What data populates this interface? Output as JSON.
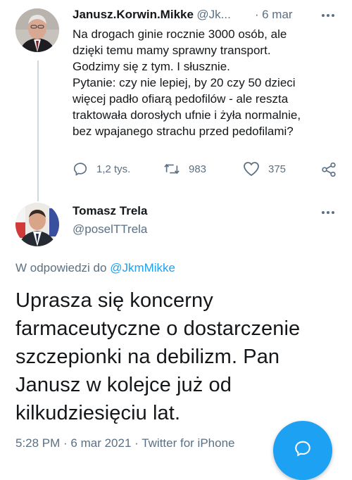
{
  "tweet1": {
    "name": "Janusz.Korwin.Mikke",
    "handle": "@Jk...",
    "dot": "·",
    "time": "6 mar",
    "lines": [
      "Na drogach ginie rocznie 3000 osób, ale",
      "dzięki temu mamy sprawny transport.",
      "Godzimy się z tym. I słusznie.",
      "Pytanie: czy nie lepiej, by 20 czy 50 dzieci",
      "więcej padło ofiarą pedofilów - ale reszta",
      "traktowała dorosłych ufnie i żyła normalnie,",
      "bez wpajanego strachu przed pedofilami?"
    ],
    "replies": "1,2 tys.",
    "retweets": "983",
    "likes": "375"
  },
  "tweet2": {
    "name": "Tomasz Trela",
    "handle": "@poselTTrela",
    "reply_prefix": "W odpowiedzi do ",
    "reply_to": "@JkmMikke",
    "lines": [
      "Uprasza się koncerny",
      "farmaceutyczne o dostarczenie",
      "szczepionki na debilizm. Pan",
      "Janusz w kolejce już od",
      "kilkudziesięciu lat."
    ],
    "timestamp": "5:28 PM · 6 mar 2021 · Twitter for iPhone"
  },
  "icons": {
    "reply": "reply-icon",
    "retweet": "retweet-icon",
    "like": "heart-icon",
    "share": "share-icon",
    "more": "more-icon",
    "compose": "compose-reply-icon"
  },
  "colors": {
    "accent": "#1da1f2",
    "secondary_text": "#5b7083",
    "line": "#cfd9de"
  }
}
